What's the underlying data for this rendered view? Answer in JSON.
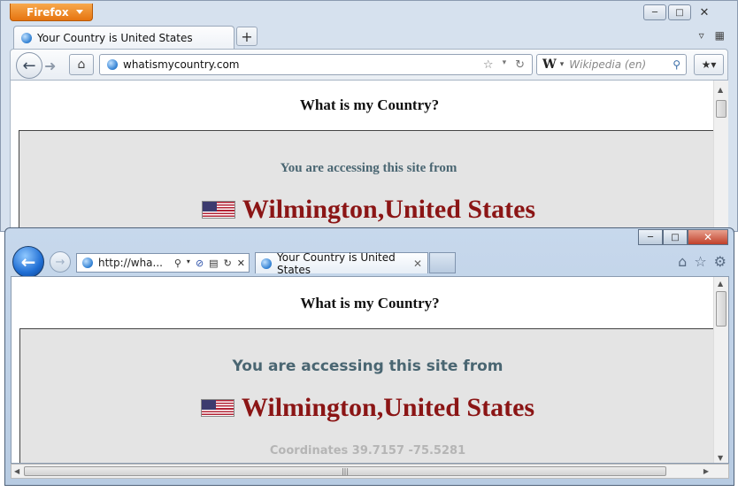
{
  "firefox": {
    "menu_button": "Firefox",
    "tab_title": "Your Country is United States",
    "new_tab_label": "+",
    "url": "whatismycountry.com",
    "search_engine_letter": "W",
    "search_placeholder": "Wikipedia (en)",
    "page": {
      "heading": "What is my Country?",
      "access_text": "You are accessing this site from",
      "location": "Wilmington,United States"
    }
  },
  "ie": {
    "url": "http://wha...",
    "tab_title": "Your Country is United States",
    "page": {
      "heading": "What is my Country?",
      "access_text": "You are accessing this site from",
      "location": "Wilmington,United States",
      "coordinates": "Coordinates 39.7157 -75.5281"
    }
  },
  "icons": {
    "firefox": [
      "minimize-icon",
      "maximize-icon",
      "close-icon",
      "back-arrow-icon",
      "forward-arrow-icon",
      "home-icon",
      "globe-icon",
      "star-icon",
      "reload-icon",
      "search-icon",
      "bookmarks-icon",
      "tab-list-icon",
      "tab-groups-icon"
    ],
    "ie": [
      "minimize-icon",
      "maximize-icon",
      "close-icon",
      "back-arrow-icon",
      "forward-arrow-icon",
      "globe-icon",
      "search-icon",
      "stop-icon",
      "compat-icon",
      "reload-icon",
      "home-icon",
      "favorites-star-icon",
      "gear-icon",
      "flag-icon"
    ]
  },
  "colors": {
    "location_red": "#8b1515",
    "access_teal": "#4a6672",
    "box_gray": "#e4e4e4",
    "firefox_orange": "#e67410",
    "ie_close_red": "#c0402a"
  }
}
